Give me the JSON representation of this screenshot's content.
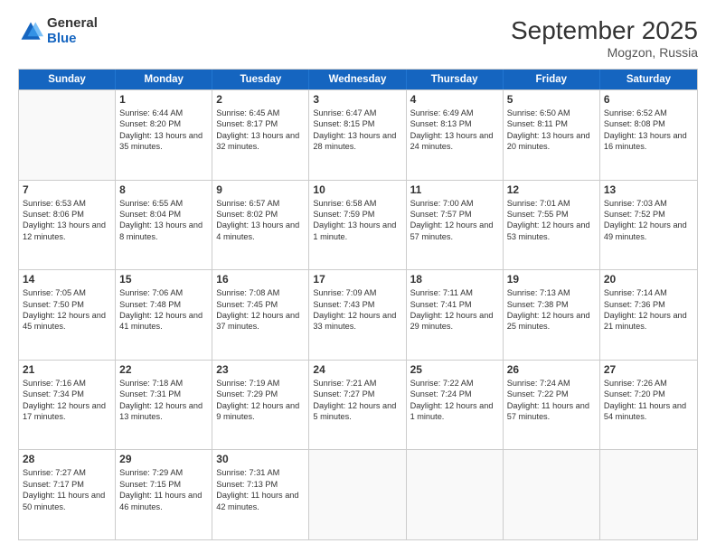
{
  "logo": {
    "general": "General",
    "blue": "Blue"
  },
  "title": "September 2025",
  "location": "Mogzon, Russia",
  "days_of_week": [
    "Sunday",
    "Monday",
    "Tuesday",
    "Wednesday",
    "Thursday",
    "Friday",
    "Saturday"
  ],
  "weeks": [
    [
      {
        "day": null
      },
      {
        "day": 1,
        "sunrise": "Sunrise: 6:44 AM",
        "sunset": "Sunset: 8:20 PM",
        "daylight": "Daylight: 13 hours and 35 minutes."
      },
      {
        "day": 2,
        "sunrise": "Sunrise: 6:45 AM",
        "sunset": "Sunset: 8:17 PM",
        "daylight": "Daylight: 13 hours and 32 minutes."
      },
      {
        "day": 3,
        "sunrise": "Sunrise: 6:47 AM",
        "sunset": "Sunset: 8:15 PM",
        "daylight": "Daylight: 13 hours and 28 minutes."
      },
      {
        "day": 4,
        "sunrise": "Sunrise: 6:49 AM",
        "sunset": "Sunset: 8:13 PM",
        "daylight": "Daylight: 13 hours and 24 minutes."
      },
      {
        "day": 5,
        "sunrise": "Sunrise: 6:50 AM",
        "sunset": "Sunset: 8:11 PM",
        "daylight": "Daylight: 13 hours and 20 minutes."
      },
      {
        "day": 6,
        "sunrise": "Sunrise: 6:52 AM",
        "sunset": "Sunset: 8:08 PM",
        "daylight": "Daylight: 13 hours and 16 minutes."
      }
    ],
    [
      {
        "day": 7,
        "sunrise": "Sunrise: 6:53 AM",
        "sunset": "Sunset: 8:06 PM",
        "daylight": "Daylight: 13 hours and 12 minutes."
      },
      {
        "day": 8,
        "sunrise": "Sunrise: 6:55 AM",
        "sunset": "Sunset: 8:04 PM",
        "daylight": "Daylight: 13 hours and 8 minutes."
      },
      {
        "day": 9,
        "sunrise": "Sunrise: 6:57 AM",
        "sunset": "Sunset: 8:02 PM",
        "daylight": "Daylight: 13 hours and 4 minutes."
      },
      {
        "day": 10,
        "sunrise": "Sunrise: 6:58 AM",
        "sunset": "Sunset: 7:59 PM",
        "daylight": "Daylight: 13 hours and 1 minute."
      },
      {
        "day": 11,
        "sunrise": "Sunrise: 7:00 AM",
        "sunset": "Sunset: 7:57 PM",
        "daylight": "Daylight: 12 hours and 57 minutes."
      },
      {
        "day": 12,
        "sunrise": "Sunrise: 7:01 AM",
        "sunset": "Sunset: 7:55 PM",
        "daylight": "Daylight: 12 hours and 53 minutes."
      },
      {
        "day": 13,
        "sunrise": "Sunrise: 7:03 AM",
        "sunset": "Sunset: 7:52 PM",
        "daylight": "Daylight: 12 hours and 49 minutes."
      }
    ],
    [
      {
        "day": 14,
        "sunrise": "Sunrise: 7:05 AM",
        "sunset": "Sunset: 7:50 PM",
        "daylight": "Daylight: 12 hours and 45 minutes."
      },
      {
        "day": 15,
        "sunrise": "Sunrise: 7:06 AM",
        "sunset": "Sunset: 7:48 PM",
        "daylight": "Daylight: 12 hours and 41 minutes."
      },
      {
        "day": 16,
        "sunrise": "Sunrise: 7:08 AM",
        "sunset": "Sunset: 7:45 PM",
        "daylight": "Daylight: 12 hours and 37 minutes."
      },
      {
        "day": 17,
        "sunrise": "Sunrise: 7:09 AM",
        "sunset": "Sunset: 7:43 PM",
        "daylight": "Daylight: 12 hours and 33 minutes."
      },
      {
        "day": 18,
        "sunrise": "Sunrise: 7:11 AM",
        "sunset": "Sunset: 7:41 PM",
        "daylight": "Daylight: 12 hours and 29 minutes."
      },
      {
        "day": 19,
        "sunrise": "Sunrise: 7:13 AM",
        "sunset": "Sunset: 7:38 PM",
        "daylight": "Daylight: 12 hours and 25 minutes."
      },
      {
        "day": 20,
        "sunrise": "Sunrise: 7:14 AM",
        "sunset": "Sunset: 7:36 PM",
        "daylight": "Daylight: 12 hours and 21 minutes."
      }
    ],
    [
      {
        "day": 21,
        "sunrise": "Sunrise: 7:16 AM",
        "sunset": "Sunset: 7:34 PM",
        "daylight": "Daylight: 12 hours and 17 minutes."
      },
      {
        "day": 22,
        "sunrise": "Sunrise: 7:18 AM",
        "sunset": "Sunset: 7:31 PM",
        "daylight": "Daylight: 12 hours and 13 minutes."
      },
      {
        "day": 23,
        "sunrise": "Sunrise: 7:19 AM",
        "sunset": "Sunset: 7:29 PM",
        "daylight": "Daylight: 12 hours and 9 minutes."
      },
      {
        "day": 24,
        "sunrise": "Sunrise: 7:21 AM",
        "sunset": "Sunset: 7:27 PM",
        "daylight": "Daylight: 12 hours and 5 minutes."
      },
      {
        "day": 25,
        "sunrise": "Sunrise: 7:22 AM",
        "sunset": "Sunset: 7:24 PM",
        "daylight": "Daylight: 12 hours and 1 minute."
      },
      {
        "day": 26,
        "sunrise": "Sunrise: 7:24 AM",
        "sunset": "Sunset: 7:22 PM",
        "daylight": "Daylight: 11 hours and 57 minutes."
      },
      {
        "day": 27,
        "sunrise": "Sunrise: 7:26 AM",
        "sunset": "Sunset: 7:20 PM",
        "daylight": "Daylight: 11 hours and 54 minutes."
      }
    ],
    [
      {
        "day": 28,
        "sunrise": "Sunrise: 7:27 AM",
        "sunset": "Sunset: 7:17 PM",
        "daylight": "Daylight: 11 hours and 50 minutes."
      },
      {
        "day": 29,
        "sunrise": "Sunrise: 7:29 AM",
        "sunset": "Sunset: 7:15 PM",
        "daylight": "Daylight: 11 hours and 46 minutes."
      },
      {
        "day": 30,
        "sunrise": "Sunrise: 7:31 AM",
        "sunset": "Sunset: 7:13 PM",
        "daylight": "Daylight: 11 hours and 42 minutes."
      },
      {
        "day": null
      },
      {
        "day": null
      },
      {
        "day": null
      },
      {
        "day": null
      }
    ]
  ]
}
